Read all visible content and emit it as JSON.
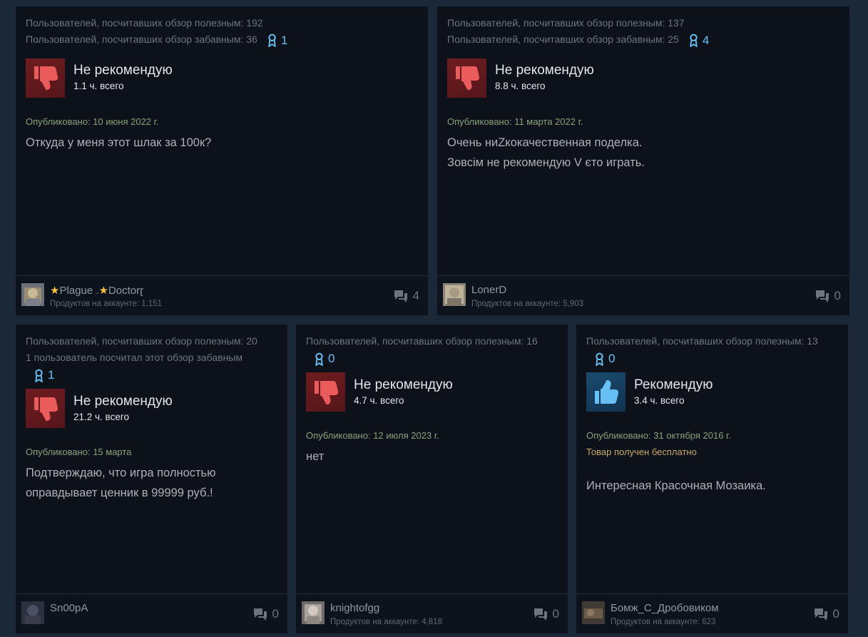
{
  "reviews": [
    {
      "helpful": "Пользователей, посчитавших обзор полезным: 192",
      "funny": "Пользователей, посчитавших обзор забавным: 36",
      "awards": "1",
      "rec": "Не рекомендую",
      "hours": "1.1 ч. всего",
      "posted": "Опубликовано: 10 июня 2022 г.",
      "text": [
        "Откуда у меня этот шлак за 100к?"
      ],
      "author_part1": "Plague",
      "author_part2": "Doctor",
      "author_sep": " .",
      "author_tail": "ɽ",
      "products": "Продуктов на аккаунте: 1,151",
      "comments": "4"
    },
    {
      "helpful": "Пользователей, посчитавших обзор полезным: 137",
      "funny": "Пользователей, посчитавших обзор забавным: 25",
      "awards": "4",
      "rec": "Не рекомендую",
      "hours": "8.8 ч. всего",
      "posted": "Опубликовано: 11 марта 2022 г.",
      "text": [
        "Очень ниZкокачественная поделка.",
        "Зовсім не рекомендую V єто играть."
      ],
      "author": "LonerD",
      "products": "Продуктов на аккаунте: 5,903",
      "comments": "0"
    },
    {
      "helpful": "Пользователей, посчитавших обзор полезным: 20",
      "funny": "1 пользователь посчитал этот обзор забавным",
      "awards": "1",
      "rec": "Не рекомендую",
      "hours": "21.2 ч. всего",
      "posted": "Опубликовано: 15 марта",
      "text": [
        "Подтверждаю, что игра полностью",
        "оправдывает ценник в 99999 руб.!"
      ],
      "author": "Sn00pA",
      "comments": "0"
    },
    {
      "helpful": "Пользователей, посчитавших обзор полезным: 16",
      "awards": "0",
      "rec": "Не рекомендую",
      "hours": "4.7 ч. всего",
      "posted": "Опубликовано: 12 июля 2023 г.",
      "text": [
        "нет"
      ],
      "author": "knightofgg",
      "products": "Продуктов на аккаунте: 4,818",
      "comments": "0"
    },
    {
      "helpful": "Пользователей, посчитавших обзор полезным: 13",
      "awards": "0",
      "rec": "Рекомендую",
      "hours": "3.4 ч. всего",
      "posted": "Опубликовано: 31 октября 2016 г.",
      "received": "Товар получен бесплатно",
      "text": [
        "Интересная Красочная Мозаика."
      ],
      "author": "Бомж_С_Дробовиком",
      "products": "Продуктов на аккаунте: 623",
      "comments": "0"
    }
  ],
  "colors": {
    "background": "#1b2838",
    "card": "#0c111a",
    "award": "#66c0f4",
    "thumb_down": "#6e1c1f",
    "thumb_up": "#1a4a6e",
    "posted": "#8ba27b",
    "received": "#c9a965"
  },
  "icons": {
    "award": "award-ribbon-icon",
    "thumb_down": "thumbs-down-icon",
    "thumb_up": "thumbs-up-icon",
    "comments": "comment-bubbles-icon"
  }
}
